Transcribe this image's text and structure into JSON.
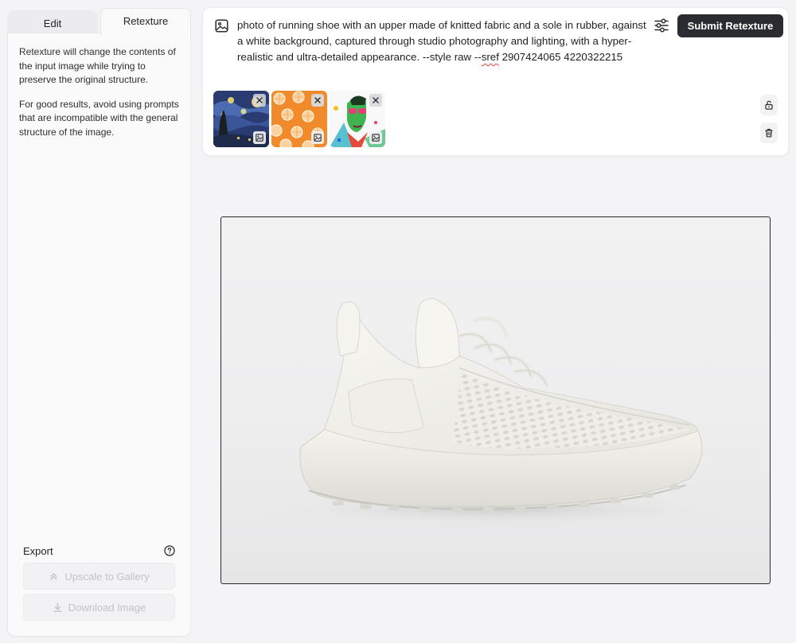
{
  "tabs": {
    "edit_label": "Edit",
    "retexture_label": "Retexture",
    "active": "retexture"
  },
  "panel": {
    "description_1": "Retexture will change the contents of the input image while trying to preserve the original structure.",
    "description_2": "For good results, avoid using prompts that are incompatible with the general structure of the image."
  },
  "export": {
    "label": "Export",
    "upscale_label": "Upscale to Gallery",
    "download_label": "Download Image",
    "help_icon": "question-circle-icon"
  },
  "prompt": {
    "text_main": "photo of running shoe with an upper made of knitted fabric and a sole in rubber, against a white background, captured through studio photography and lighting, with a hyper-realistic and ultra-detailed appearance. --style raw --",
    "text_flagged": "sref",
    "text_tail": " 2907424065 4220322215",
    "submit_label": "Submit Retexture",
    "leading_icon": "image-icon",
    "settings_icon": "sliders-icon"
  },
  "reference_images": [
    {
      "name": "starry-night-thumbnail",
      "dominant_color": "#2c3f78"
    },
    {
      "name": "orange-slices-thumbnail",
      "dominant_color": "#f1892b"
    },
    {
      "name": "pop-art-portrait-thumbnail",
      "dominant_color": "#3fb34f"
    }
  ],
  "side_actions": {
    "lock_icon": "unlock-icon",
    "trash_icon": "trash-icon"
  },
  "colors": {
    "submit_bg": "#2b2c31",
    "background": "#f4f4f6",
    "panel_bg": "#fafafb"
  }
}
